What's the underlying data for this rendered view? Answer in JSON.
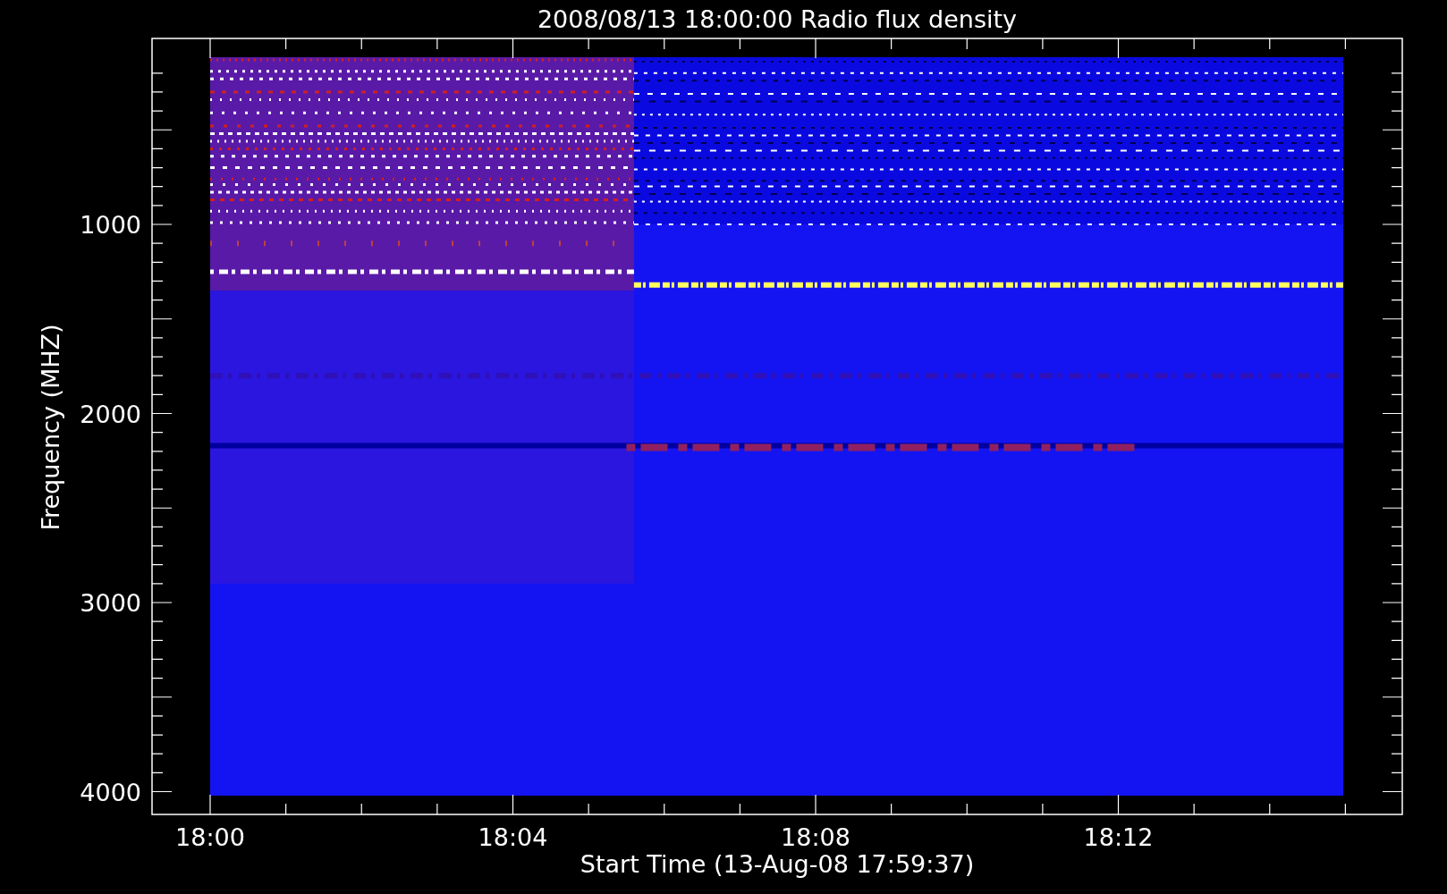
{
  "plot": {
    "title": "2008/08/13 18:00:00 Radio flux density",
    "ylabel": "Frequency (MHZ)",
    "xlabel": "Start Time (13-Aug-08 17:59:37)",
    "yticks": [
      "1000",
      "2000",
      "3000",
      "4000"
    ],
    "xticks": [
      "18:00",
      "18:04",
      "18:08",
      "18:12"
    ]
  }
}
